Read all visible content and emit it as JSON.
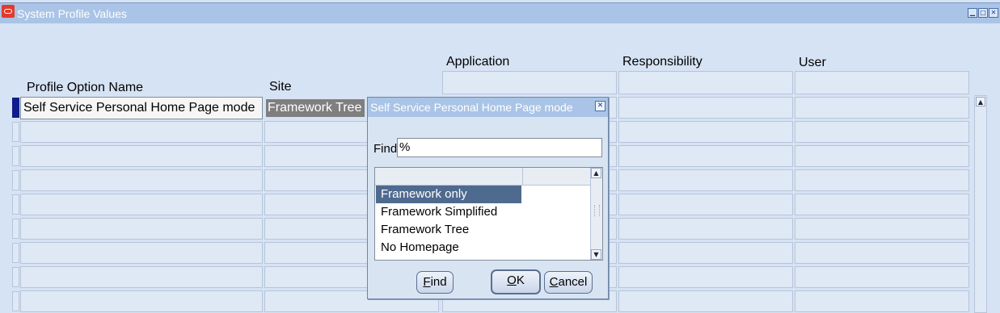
{
  "window": {
    "title": "System Profile Values",
    "controls": [
      "minimize-icon",
      "maximize-icon",
      "close-icon"
    ]
  },
  "columns": {
    "profile_option_name": "Profile Option Name",
    "site": "Site",
    "application": "Application",
    "responsibility": "Responsibility",
    "user": "User"
  },
  "rows": [
    {
      "profile_option_name": "Self Service Personal Home Page mode",
      "site": "Framework Tree"
    }
  ],
  "lov_dialog": {
    "title": "Self Service Personal Home Page mode",
    "find_label": "Find",
    "find_value": "%",
    "options": [
      "Framework only",
      "Framework Simplified",
      "Framework Tree",
      "No Homepage"
    ],
    "selected_index": 0,
    "buttons": {
      "find": {
        "accel": "F",
        "rest": "ind"
      },
      "ok": {
        "accel": "O",
        "rest": "K"
      },
      "cancel": {
        "accel": "C",
        "rest": "ancel"
      }
    }
  },
  "colors": {
    "background": "#d6e3f4",
    "titlebar": "#a9c4e6",
    "current_record": "#101c8c",
    "selection": "#4f6a8f"
  }
}
